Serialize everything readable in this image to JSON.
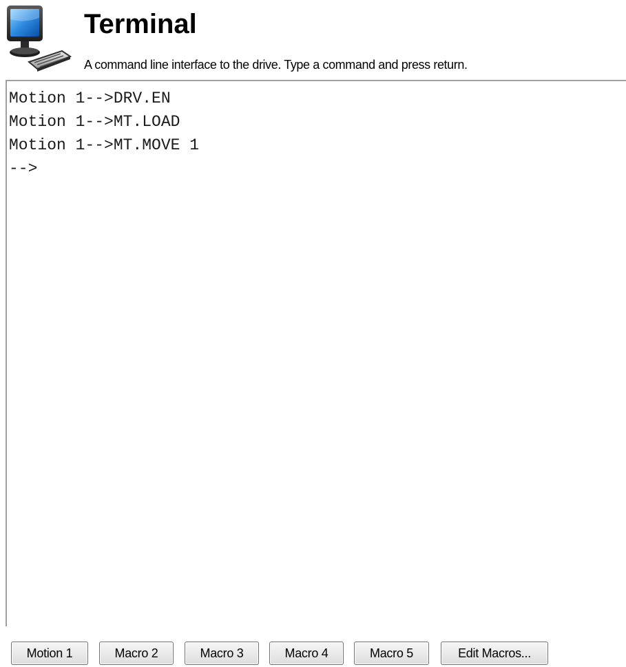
{
  "header": {
    "icon": "terminal-computer-icon",
    "title": "Terminal",
    "subtitle": "A command line interface to the drive. Type a command and press return."
  },
  "terminal": {
    "lines": [
      "Motion 1-->DRV.EN",
      "Motion 1-->MT.LOAD",
      "Motion 1-->MT.MOVE 1",
      "-->"
    ]
  },
  "buttons": [
    {
      "label": "Motion 1"
    },
    {
      "label": "Macro 2"
    },
    {
      "label": "Macro 3"
    },
    {
      "label": "Macro 4"
    },
    {
      "label": "Macro 5"
    },
    {
      "label": "Edit Macros..."
    }
  ],
  "colors": {
    "background": "#ffffff",
    "border": "#a0a0a0",
    "button_border": "#707070"
  }
}
